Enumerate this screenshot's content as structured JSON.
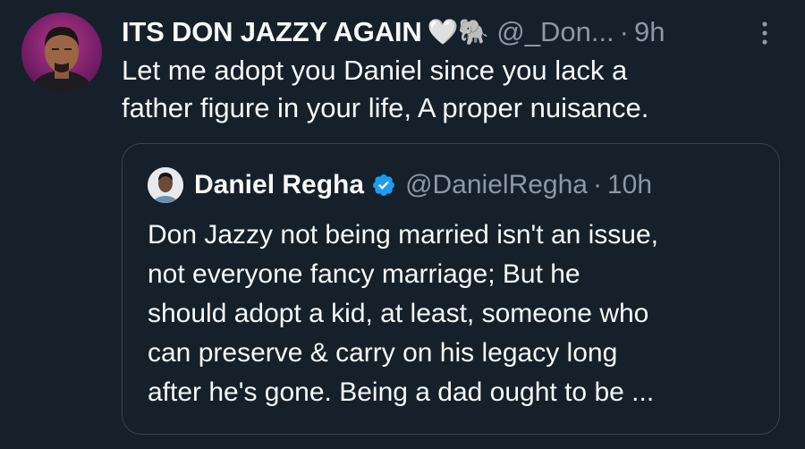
{
  "tweet": {
    "display_name": "ITS DON JAZZY AGAIN",
    "name_emojis": "🤍🐘",
    "handle": "@_Don...",
    "separator": "·",
    "time": "9h",
    "text_lines": [
      "Let me adopt you Daniel since you lack a",
      "father figure in your life, A proper nuisance."
    ]
  },
  "quoted_tweet": {
    "display_name": "Daniel Regha",
    "verified": true,
    "handle": "@DanielRegha",
    "separator": "·",
    "time": "10h",
    "text_lines": [
      "Don Jazzy not being married isn't an issue,",
      "not everyone fancy marriage; But he",
      "should adopt a kid, at least, someone who",
      "can preserve & carry on his legacy long",
      "after he's gone. Being a dad ought to be ..."
    ]
  },
  "colors": {
    "background": "#15202b",
    "text_primary": "#f7f9f9",
    "text_secondary": "#8b98a5",
    "border": "#38444d",
    "verified_badge": "#1d9bf0"
  },
  "icons": {
    "more": "more-vertical-icon",
    "verified": "verified-badge-icon"
  }
}
